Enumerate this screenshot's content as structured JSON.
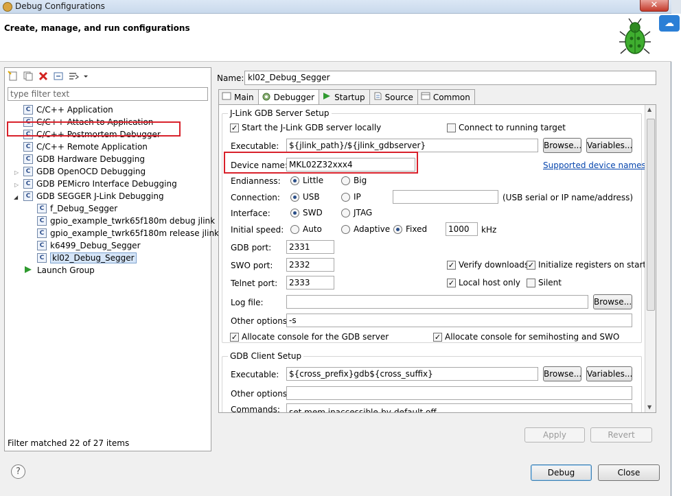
{
  "window": {
    "title": "Debug Configurations",
    "close_glyph": "✕"
  },
  "header": {
    "title": "Create, manage, and run configurations"
  },
  "left": {
    "filter_placeholder": "type filter text",
    "tree": [
      {
        "label": "C/C++ Application",
        "icon": "c-config-icon"
      },
      {
        "label": "C/C++ Attach to Application",
        "icon": "c-config-icon"
      },
      {
        "label": "C/C++ Postmortem Debugger",
        "icon": "c-config-icon"
      },
      {
        "label": "C/C++ Remote Application",
        "icon": "c-config-icon"
      },
      {
        "label": "GDB Hardware Debugging",
        "icon": "c-config-icon"
      },
      {
        "label": "GDB OpenOCD Debugging",
        "icon": "c-config-icon"
      },
      {
        "label": "GDB PEMicro Interface Debugging",
        "icon": "c-config-icon"
      },
      {
        "label": "GDB SEGGER J-Link Debugging",
        "icon": "c-config-icon"
      },
      {
        "label": "f_Debug_Segger",
        "icon": "c-config-icon"
      },
      {
        "label": "gpio_example_twrk65f180m debug jlink",
        "icon": "c-config-icon"
      },
      {
        "label": "gpio_example_twrk65f180m release jlink",
        "icon": "c-config-icon"
      },
      {
        "label": "k6499_Debug_Segger",
        "icon": "c-config-icon"
      },
      {
        "label": "kl02_Debug_Segger",
        "icon": "c-config-icon"
      },
      {
        "label": "Launch Group",
        "icon": "launch-group-icon"
      }
    ],
    "status": "Filter matched 22 of 27 items"
  },
  "right": {
    "name_label": "Name:",
    "name_value": "kl02_Debug_Segger",
    "tabs": [
      "Main",
      "Debugger",
      "Startup",
      "Source",
      "Common"
    ],
    "server": {
      "title": "J-Link GDB Server Setup",
      "start_locally": "Start the J-Link GDB server locally",
      "connect_running": "Connect to running target",
      "executable_label": "Executable:",
      "executable_value": "${jlink_path}/${jlink_gdbserver}",
      "browse": "Browse...",
      "variables": "Variables...",
      "device_label": "Device name:",
      "device_value": "MKL02Z32xxx4",
      "supported_link": "Supported device names",
      "endianness_label": "Endianness:",
      "little": "Little",
      "big": "Big",
      "connection_label": "Connection:",
      "usb": "USB",
      "ip": "IP",
      "ip_hint": "(USB serial or IP name/address)",
      "interface_label": "Interface:",
      "swd": "SWD",
      "jtag": "JTAG",
      "speed_label": "Initial speed:",
      "auto": "Auto",
      "adaptive": "Adaptive",
      "fixed": "Fixed",
      "speed_value": "1000",
      "speed_unit": "kHz",
      "gdb_port_label": "GDB port:",
      "gdb_port": "2331",
      "swo_port_label": "SWO port:",
      "swo_port": "2332",
      "telnet_port_label": "Telnet port:",
      "telnet_port": "2333",
      "verify": "Verify downloads",
      "init_regs": "Initialize registers on start",
      "local_host": "Local host only",
      "silent": "Silent",
      "log_label": "Log file:",
      "log_value": "",
      "other_label": "Other options:",
      "other_value": "-s",
      "alloc_gdb": "Allocate console for the GDB server",
      "alloc_semi": "Allocate console for semihosting and SWO"
    },
    "client": {
      "title": "GDB Client Setup",
      "executable_label": "Executable:",
      "executable_value": "${cross_prefix}gdb${cross_suffix}",
      "browse": "Browse...",
      "variables": "Variables...",
      "other_label": "Other options:",
      "other_value": "",
      "commands_label": "Commands:",
      "commands_value": "set mem inaccessible-by-default off"
    },
    "apply": "Apply",
    "revert": "Revert"
  },
  "footer": {
    "help": "?",
    "debug": "Debug",
    "close": "Close"
  },
  "colors": {
    "highlight": "#d8202a",
    "selection": "#d5e5f8",
    "link": "#0645ad"
  }
}
